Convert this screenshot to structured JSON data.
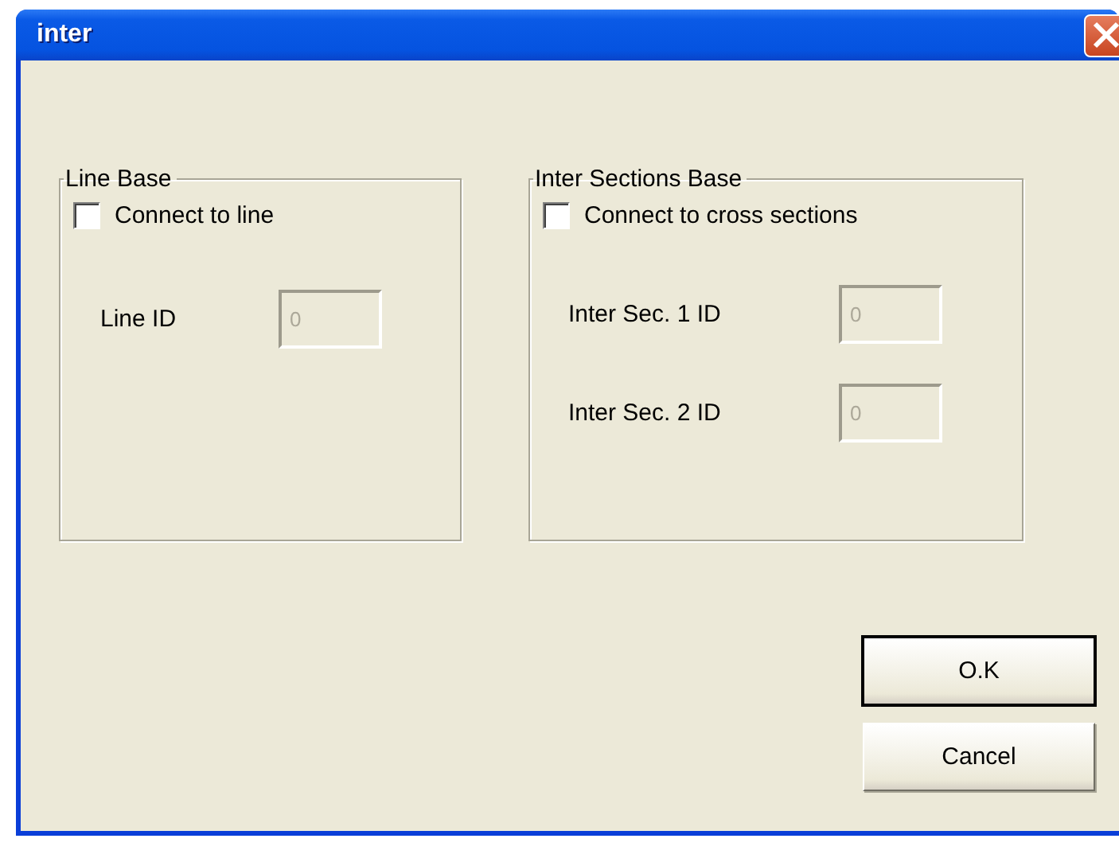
{
  "window": {
    "title": "inter"
  },
  "groups": [
    {
      "title": "Line Base",
      "checkbox": {
        "label": "Connect to line",
        "checked": false
      },
      "fields": [
        {
          "label": "Line ID",
          "value": "0",
          "disabled": true
        }
      ]
    },
    {
      "title": "Inter Sections Base",
      "checkbox": {
        "label": "Connect to cross sections",
        "checked": false
      },
      "fields": [
        {
          "label": "Inter Sec. 1 ID",
          "value": "0",
          "disabled": true
        },
        {
          "label": "Inter Sec. 2 ID",
          "value": "0",
          "disabled": true
        }
      ]
    }
  ],
  "buttons": [
    {
      "label": "O.K",
      "default": true
    },
    {
      "label": "Cancel",
      "default": false
    }
  ]
}
